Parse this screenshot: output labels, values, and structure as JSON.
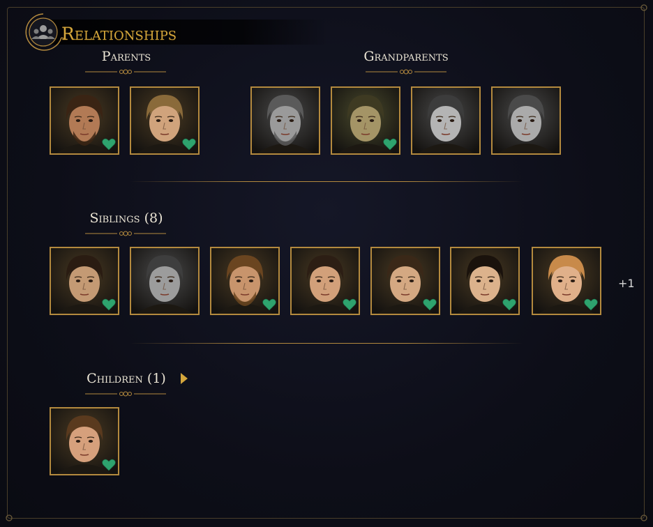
{
  "header": {
    "title": "Relationships"
  },
  "sections": {
    "parents": {
      "label": "Parents"
    },
    "grandparents": {
      "label": "Grandparents"
    },
    "siblings": {
      "label": "Siblings (8)",
      "overflow": "+1"
    },
    "children": {
      "label": "Children (1)"
    }
  },
  "portraits": {
    "parents": [
      {
        "tone": "warm",
        "hair": "#3a2414",
        "skin": "#b27a55",
        "beard": true,
        "heart": true
      },
      {
        "tone": "warm",
        "hair": "#8a6a3a",
        "skin": "#d0a37c",
        "beard": false,
        "heart": true
      }
    ],
    "grandparents": [
      {
        "tone": "gray",
        "hair": "#5a5a5a",
        "skin": "#9a9a9a",
        "beard": true,
        "heart": false
      },
      {
        "tone": "olive",
        "hair": "#3e3a22",
        "skin": "#a49466",
        "beard": false,
        "heart": true
      },
      {
        "tone": "gray",
        "hair": "#3c3c3c",
        "skin": "#b4b4b4",
        "beard": false,
        "heart": false
      },
      {
        "tone": "gray",
        "hair": "#4a4a4a",
        "skin": "#aaaaaa",
        "beard": false,
        "heart": false
      }
    ],
    "siblings": [
      {
        "tone": "warm",
        "hair": "#2a1c12",
        "skin": "#c49a74",
        "beard": false,
        "heart": true
      },
      {
        "tone": "gray",
        "hair": "#3e3e3e",
        "skin": "#9c9c9c",
        "beard": false,
        "heart": false
      },
      {
        "tone": "warm",
        "hair": "#6a4520",
        "skin": "#c8946c",
        "beard": true,
        "heart": true
      },
      {
        "tone": "warm",
        "hair": "#2c1e14",
        "skin": "#d2a07a",
        "beard": false,
        "heart": true
      },
      {
        "tone": "warm",
        "hair": "#3a2818",
        "skin": "#d4a882",
        "beard": false,
        "heart": true
      },
      {
        "tone": "warm",
        "hair": "#1a120c",
        "skin": "#dcb28c",
        "beard": false,
        "heart": true
      },
      {
        "tone": "warm",
        "hair": "#c88a4a",
        "skin": "#e0b08a",
        "beard": false,
        "heart": true
      }
    ],
    "children": [
      {
        "tone": "warm",
        "hair": "#5a3a1e",
        "skin": "#d6a07c",
        "beard": false,
        "heart": true
      }
    ]
  },
  "colors": {
    "accent": "#b48a3e",
    "title": "#d4a63c",
    "heart": "#2ea36e",
    "background": "#0c0d16"
  },
  "icons": [
    "relationships-emblem-icon",
    "heart-icon",
    "chevron-right-icon"
  ]
}
